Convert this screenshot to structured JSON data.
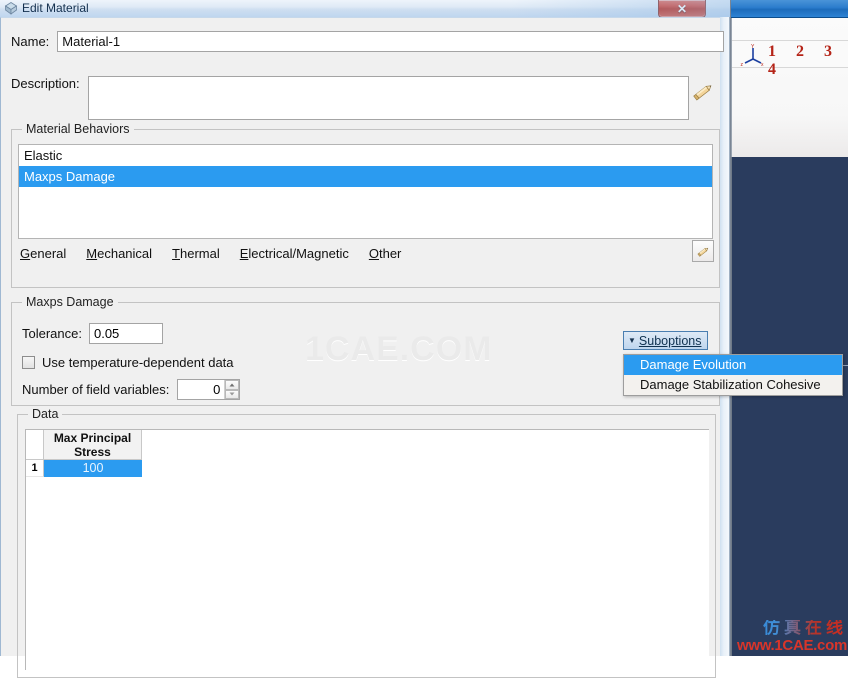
{
  "window": {
    "title": "Edit Material",
    "icon": "material-diamond-icon",
    "close_label": "✕"
  },
  "form": {
    "name_label": "Name:",
    "name_value": "Material-1",
    "description_label": "Description:",
    "description_value": "",
    "description_placeholder": "",
    "edit_description_icon": "pencil-icon"
  },
  "behaviors": {
    "group_title": "Material Behaviors",
    "items": [
      {
        "label": "Elastic",
        "selected": false
      },
      {
        "label": "Maxps Damage",
        "selected": true
      }
    ],
    "menu_tabs": [
      {
        "label": "General",
        "mnemonic": "G",
        "rest": "eneral"
      },
      {
        "label": "Mechanical",
        "mnemonic": "M",
        "rest": "echanical"
      },
      {
        "label": "Thermal",
        "mnemonic": "T",
        "rest": "hermal"
      },
      {
        "label": "Electrical/Magnetic",
        "mnemonic": "E",
        "rest": "lectrical/Magnetic"
      },
      {
        "label": "Other",
        "mnemonic": "O",
        "rest": "ther"
      }
    ],
    "edit_icon": "pencil-icon"
  },
  "maxps": {
    "group_title": "Maxps Damage",
    "tolerance_label": "Tolerance:",
    "tolerance_value": "0.05",
    "temp_dependent_label": "Use temperature-dependent data",
    "temp_dependent_checked": false,
    "field_vars_label": "Number of field variables:",
    "field_vars_value": "0"
  },
  "suboptions": {
    "button_label": "Suboptions",
    "caret": "▼",
    "menu": [
      {
        "label": "Damage Evolution",
        "highlighted": true
      },
      {
        "label": "Damage Stabilization Cohesive",
        "highlighted": false
      }
    ]
  },
  "data": {
    "group_title": "Data",
    "columns": [
      "Max Principal Stress"
    ],
    "rows": [
      {
        "index": "1",
        "values": [
          "100"
        ],
        "selected": true
      }
    ]
  },
  "background": {
    "toolbar_numbers": "1 2 3 4",
    "triad_labels": {
      "y": "Y",
      "x": "x",
      "z": "z"
    }
  },
  "watermarks": {
    "center": "1CAE.COM",
    "corner_cn": "仿真在线",
    "corner_url": "www.1CAE.com"
  },
  "colors": {
    "selection_blue": "#2b9bf0",
    "viewport_navy": "#2a3c5e",
    "accent_red": "#d8352a"
  }
}
